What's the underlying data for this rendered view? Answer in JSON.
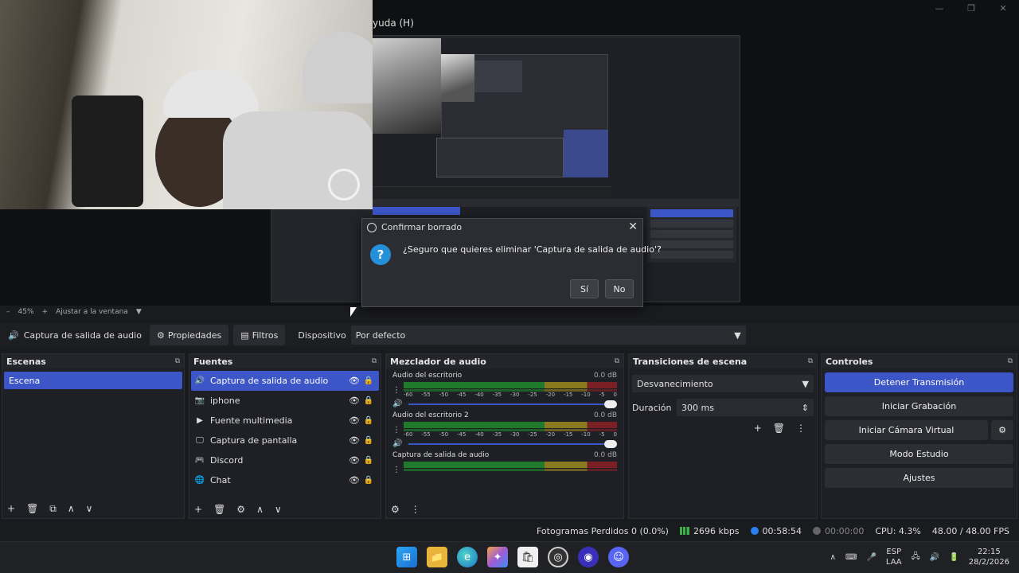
{
  "window": {
    "menu_help": "yuda (H)",
    "minimize": "—",
    "maximize": "❐",
    "close": "✕"
  },
  "zoom": {
    "minus": "–",
    "value": "45%",
    "plus": "+",
    "fit": "Ajustar a la ventana",
    "fit_arrow": "▼"
  },
  "dialog": {
    "title": "Confirmar borrado",
    "message": "¿Seguro que quieres eliminar 'Captura de salida de audio'?",
    "yes": "Sí",
    "no": "No",
    "close": "✕",
    "question_mark": "?"
  },
  "propbar": {
    "source_name": "Captura de salida de audio",
    "properties_label": "Propiedades",
    "filters_label": "Filtros",
    "device_label": "Dispositivo",
    "device_value": "Por defecto",
    "dropdown_arrow": "▼"
  },
  "scenes": {
    "title": "Escenas",
    "float": "⧉",
    "items": [
      "Escena"
    ],
    "footer": [
      "+",
      "🗑",
      "⧉",
      "∧",
      "∨"
    ]
  },
  "sources": {
    "title": "Fuentes",
    "float": "⧉",
    "items": [
      {
        "icon": "🔊",
        "name": "Captura de salida de audio",
        "eye": "👁",
        "lock": "🔒"
      },
      {
        "icon": "📷",
        "name": "iphone",
        "eye": "👁",
        "lock": "🔒"
      },
      {
        "icon": "▶",
        "name": "Fuente multimedia",
        "eye": "👁",
        "lock": "🔒"
      },
      {
        "icon": "🖵",
        "name": "Captura de pantalla",
        "eye": "👁",
        "lock": "🔒"
      },
      {
        "icon": "🎮",
        "name": "Discord",
        "eye": "👁",
        "lock": "🔒"
      },
      {
        "icon": "🌐",
        "name": "Chat",
        "eye": "👁",
        "lock": "🔒"
      }
    ],
    "footer": [
      "+",
      "🗑",
      "⚙",
      "∧",
      "∨"
    ]
  },
  "mixer": {
    "title": "Mezclador de audio",
    "float": "⧉",
    "ticks": [
      "-60",
      "-55",
      "-50",
      "-45",
      "-40",
      "-35",
      "-30",
      "-25",
      "-20",
      "-15",
      "-10",
      "-5",
      "0"
    ],
    "tracks": [
      {
        "name": "Audio del escritorio",
        "db": "0.0 dB",
        "volume": 1.0
      },
      {
        "name": "Audio del escritorio 2",
        "db": "0.0 dB",
        "volume": 1.0
      },
      {
        "name": "Captura de salida de audio",
        "db": "0.0 dB",
        "volume": 1.0
      }
    ],
    "menu_dots": "⋮",
    "speaker": "🔊",
    "footer": [
      "⚙",
      "⋮"
    ]
  },
  "transitions": {
    "title": "Transiciones de escena",
    "float": "⧉",
    "selected": "Desvanecimiento",
    "arrow": "▼",
    "duration_label": "Duración",
    "duration_value": "300 ms",
    "stepper": "⇕",
    "buttons": [
      "+",
      "🗑",
      "⋮"
    ]
  },
  "controls": {
    "title": "Controles",
    "float": "⧉",
    "stop_stream": "Detener Transmisión",
    "start_recording": "Iniciar Grabación",
    "start_virtual_cam": "Iniciar Cámara Virtual",
    "gear": "⚙",
    "studio_mode": "Modo Estudio",
    "settings": "Ajustes"
  },
  "status": {
    "dropped": "Fotogramas Perdidos 0 (0.0%)",
    "bitrate": "2696 kbps",
    "live_time": "00:58:54",
    "rec_time": "00:00:00",
    "cpu": "CPU: 4.3%",
    "fps": "48.00 / 48.00 FPS"
  },
  "taskbar": {
    "apps": [
      "⊞",
      "📁",
      "e",
      "✦",
      "🛍",
      "◎",
      "◉",
      "☺"
    ],
    "tray_chevron": "∧",
    "lang_top": "ESP",
    "lang_bottom": "LAA",
    "time": "22:15",
    "date": "28/2/2026"
  },
  "colors": {
    "accent": "#3c56c7",
    "dock_bg": "#1f2025",
    "meter_green": "#1f7a2c",
    "meter_yellow": "#8a7a1f",
    "meter_red": "#7a1f24"
  }
}
